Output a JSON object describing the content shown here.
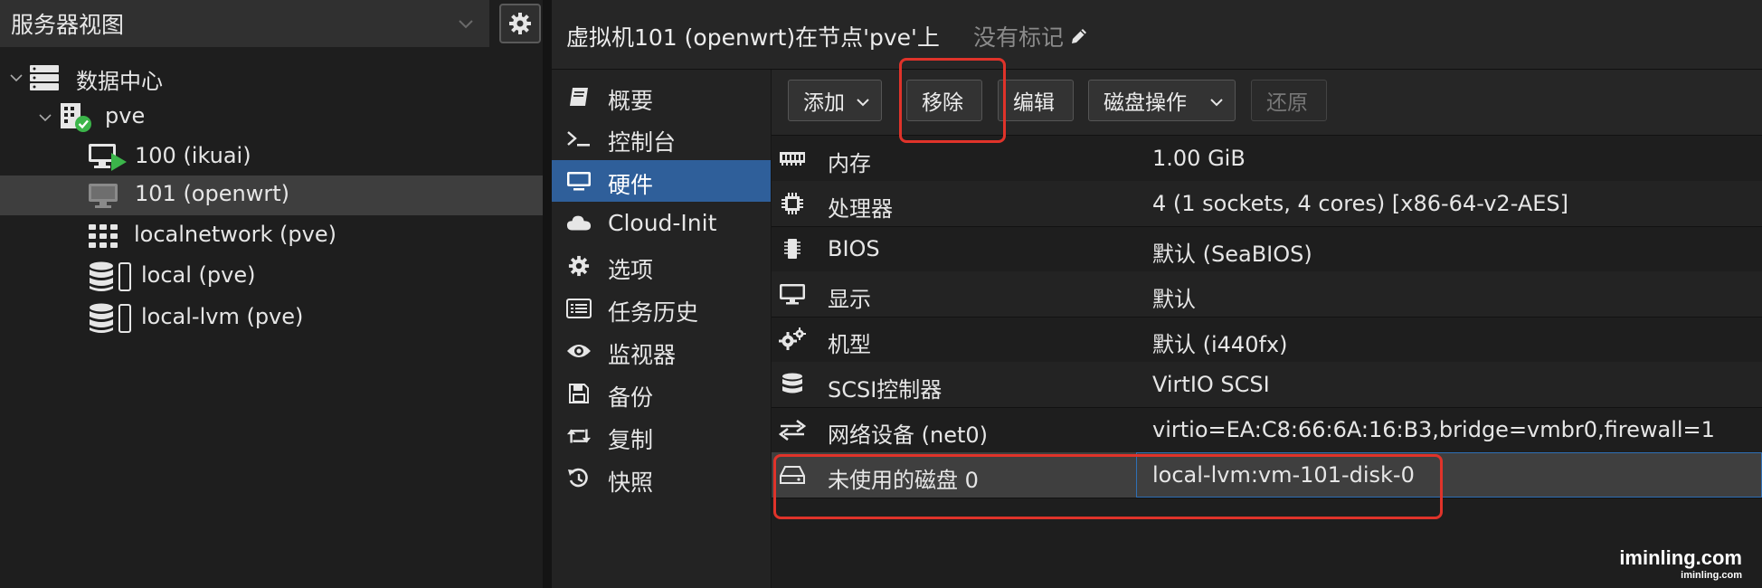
{
  "left": {
    "view_select": "服务器视图",
    "tree": [
      {
        "label": "数据中心",
        "icon": "datacenter-icon"
      },
      {
        "label": "pve",
        "icon": "node-online-icon"
      },
      {
        "label": "100 (ikuai)",
        "icon": "vm-running-icon"
      },
      {
        "label": "101 (openwrt)",
        "icon": "vm-stopped-icon"
      },
      {
        "label": "localnetwork (pve)",
        "icon": "network-grid-icon"
      },
      {
        "label": "local (pve)",
        "icon": "storage-icon"
      },
      {
        "label": "local-lvm (pve)",
        "icon": "storage-icon"
      }
    ]
  },
  "header": {
    "title": "虚拟机101 (openwrt)在节点'pve'上",
    "tags": "没有标记"
  },
  "nav": [
    {
      "label": "概要",
      "icon": "summary-book-icon"
    },
    {
      "label": "控制台",
      "icon": "terminal-icon"
    },
    {
      "label": "硬件",
      "icon": "monitor-icon"
    },
    {
      "label": "Cloud-Init",
      "icon": "cloud-icon"
    },
    {
      "label": "选项",
      "icon": "gear-icon"
    },
    {
      "label": "任务历史",
      "icon": "list-icon"
    },
    {
      "label": "监视器",
      "icon": "eye-icon"
    },
    {
      "label": "备份",
      "icon": "save-icon"
    },
    {
      "label": "复制",
      "icon": "retweet-icon"
    },
    {
      "label": "快照",
      "icon": "history-icon"
    }
  ],
  "toolbar": {
    "add": "添加",
    "remove": "移除",
    "edit": "编辑",
    "disk_action": "磁盘操作",
    "revert": "还原"
  },
  "hardware": [
    {
      "key": "内存",
      "value": "1.00 GiB",
      "icon": "memory-icon"
    },
    {
      "key": "处理器",
      "value": "4 (1 sockets, 4 cores) [x86-64-v2-AES]",
      "icon": "cpu-icon"
    },
    {
      "key": "BIOS",
      "value": "默认 (SeaBIOS)",
      "icon": "bios-chip-icon"
    },
    {
      "key": "显示",
      "value": "默认",
      "icon": "display-icon"
    },
    {
      "key": "机型",
      "value": "默认 (i440fx)",
      "icon": "machine-gears-icon"
    },
    {
      "key": "SCSI控制器",
      "value": "VirtIO SCSI",
      "icon": "database-icon"
    },
    {
      "key": "网络设备 (net0)",
      "value": "virtio=EA:C8:66:6A:16:B3,bridge=vmbr0,firewall=1",
      "icon": "exchange-icon"
    },
    {
      "key": "未使用的磁盘 0",
      "value": "local-lvm:vm-101-disk-0",
      "icon": "hdd-icon"
    }
  ],
  "watermark": {
    "big": "iminling.com",
    "small": "iminling.com"
  },
  "colors": {
    "selection_blue": "#2f5f9a",
    "highlight_red": "#e0332a",
    "running_green": "#3bb54a"
  }
}
